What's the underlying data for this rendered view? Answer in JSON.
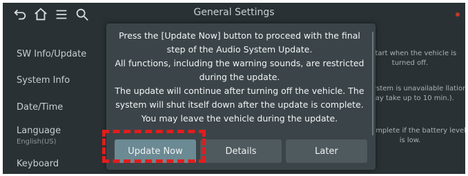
{
  "header": {
    "title": "General Settings",
    "icons": [
      "back-icon",
      "home-icon",
      "menu-icon",
      "search-icon"
    ]
  },
  "sidebar": {
    "items": [
      {
        "label": "SW Info/Update"
      },
      {
        "label": "System Info"
      },
      {
        "label": "Date/Time"
      },
      {
        "label": "Language",
        "sub": "English(US)"
      },
      {
        "label": "Keyboard"
      }
    ]
  },
  "content": {
    "line1": "ill start when the vehicle is turned off.",
    "line2": "tion system is unavailable llation (may take up to 10 min.).",
    "line3": "not complete if the battery level is low."
  },
  "dialog": {
    "message": "Press the [Update Now] button to proceed with the final step of the Audio System Update.\nAll functions, including the warning sounds, are restricted during the update.\nThe update will continue after turning off the vehicle. The system will shut itself down after the update is complete.\nYou may leave the vehicle during the update.",
    "buttons": {
      "update_now": "Update Now",
      "details": "Details",
      "later": "Later"
    }
  },
  "colors": {
    "highlight": "#e11d1d",
    "primary_button": "#6b8a93"
  }
}
